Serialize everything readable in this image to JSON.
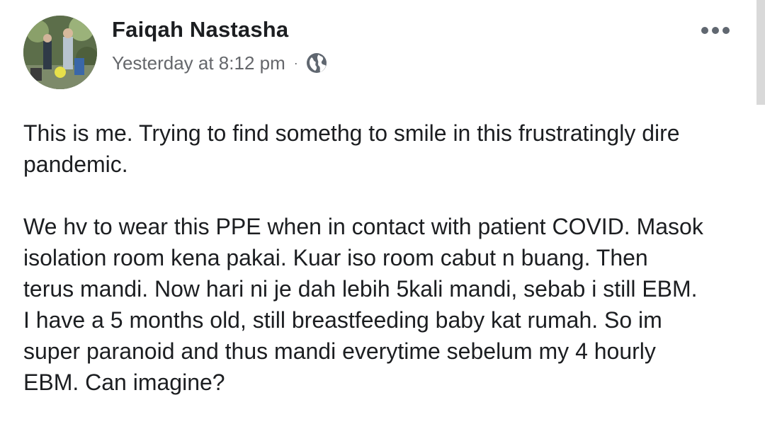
{
  "post": {
    "author": "Faiqah Nastasha",
    "timestamp": "Yesterday at 8:12 pm",
    "separator": "·",
    "privacy_icon": "globe-icon",
    "more_icon": "more-options-icon",
    "paragraphs": [
      {
        "lines": [
          "This is me. Trying to find somethg to smile in this frustratingly dire",
          "pandemic."
        ]
      },
      {
        "lines": [
          "We hv to wear this PPE when in contact with patient COVID. Masok",
          "isolation room kena pakai. Kuar iso room cabut n buang. Then",
          "terus mandi. Now hari ni je dah lebih 5kali mandi, sebab i still EBM.",
          "I have a 5 months old, still breastfeeding baby kat rumah. So im",
          "super paranoid and thus mandi everytime sebelum my 4 hourly",
          "EBM. Can imagine?"
        ]
      }
    ]
  }
}
